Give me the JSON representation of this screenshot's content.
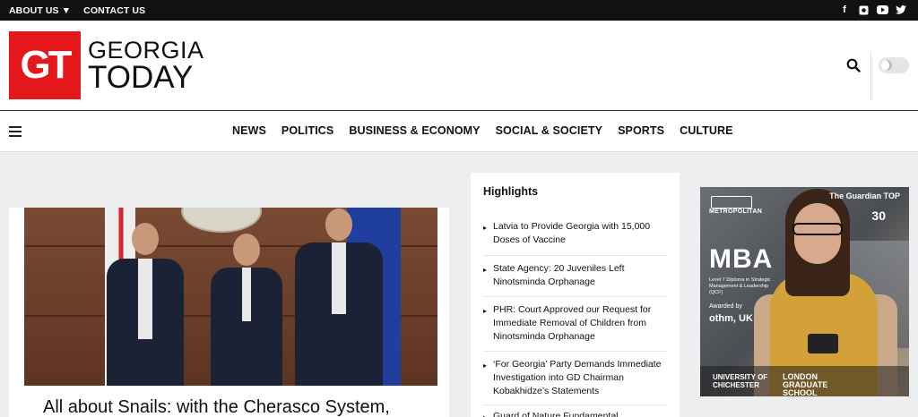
{
  "topbar": {
    "links": [
      "ABOUT US",
      "CONTACT US"
    ],
    "social_icons": [
      "facebook-icon",
      "instagram-icon",
      "youtube-icon",
      "twitter-icon"
    ]
  },
  "header": {
    "logo_mark": "GT",
    "logo_line1": "GEORGIA",
    "logo_line2": "TODAY"
  },
  "nav": {
    "items": [
      "NEWS",
      "POLITICS",
      "BUSINESS & ECONOMY",
      "SOCIAL & SOCIETY",
      "SPORTS",
      "CULTURE"
    ]
  },
  "article": {
    "headline": "All about Snails: with the Cherasco System,"
  },
  "highlights": {
    "title": "Highlights",
    "items": [
      "Latvia to Provide Georgia with 15,000 Doses of Vaccine",
      "State Agency: 20 Juveniles Left Ninotsminda Orphanage",
      "PHR: Court Approved our Request for Immediate Removal of Children from Ninotsminda Orphanage",
      "‘For Georgia’ Party Demands Immediate Investigation into GD Chairman Kobakhidze’s Statements",
      "Guard of Nature Fundamental..."
    ]
  },
  "ad": {
    "metropolitan": "METROPOLITAN",
    "mba": "MBA",
    "subtitle": "Level 7 Diploma in Strategic Management & Leadership (QCF)",
    "awarded": "Awarded by",
    "othm": "othm, UK",
    "guardian": "The Guardian TOP",
    "thirty": "30",
    "chichester": "UNIVERSITY OF CHICHESTER",
    "london": "LONDON GRADUATE SCHOOL"
  },
  "colors": {
    "brand_red": "#e4181b",
    "topbar": "#111111",
    "page_bg": "#edeef0"
  }
}
